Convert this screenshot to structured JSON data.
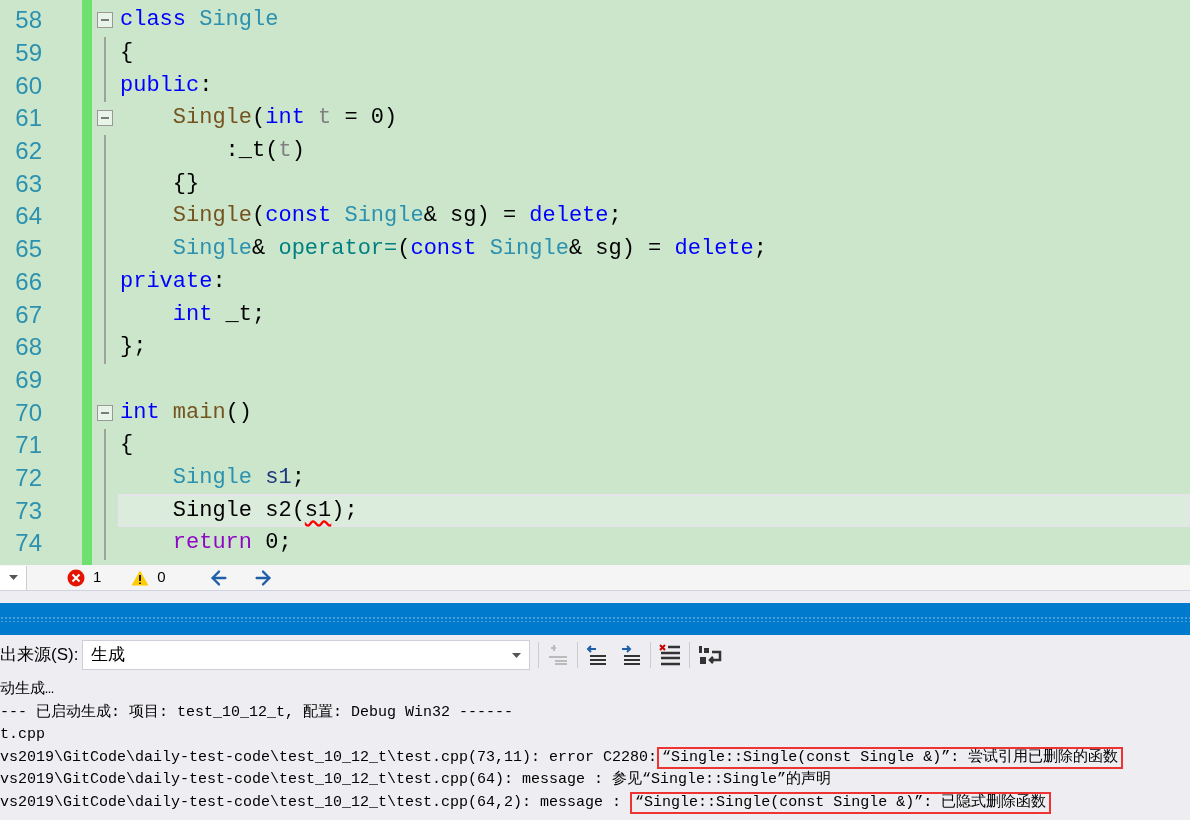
{
  "editor": {
    "lines": [
      {
        "number": "58",
        "fold": true,
        "current": false,
        "tokens": [
          {
            "text": "class ",
            "kind": "keyword"
          },
          {
            "text": "Single",
            "kind": "type"
          }
        ]
      },
      {
        "number": "59",
        "fold": false,
        "current": false,
        "tokens": [
          {
            "text": "{",
            "kind": "plain"
          }
        ]
      },
      {
        "number": "60",
        "fold": false,
        "current": false,
        "tokens": [
          {
            "text": "public",
            "kind": "keyword"
          },
          {
            "text": ":",
            "kind": "plain"
          }
        ]
      },
      {
        "number": "61",
        "fold": true,
        "current": false,
        "tokens": [
          {
            "text": "    Single",
            "kind": "function"
          },
          {
            "text": "(",
            "kind": "plain"
          },
          {
            "text": "int ",
            "kind": "keyword"
          },
          {
            "text": "t",
            "kind": "parameter"
          },
          {
            "text": " = 0)",
            "kind": "plain"
          }
        ]
      },
      {
        "number": "62",
        "fold": false,
        "current": false,
        "tokens": [
          {
            "text": "        :_t(",
            "kind": "plain"
          },
          {
            "text": "t",
            "kind": "parameter"
          },
          {
            "text": ")",
            "kind": "plain"
          }
        ]
      },
      {
        "number": "63",
        "fold": false,
        "current": false,
        "tokens": [
          {
            "text": "    {}",
            "kind": "plain"
          }
        ]
      },
      {
        "number": "64",
        "fold": false,
        "current": false,
        "tokens": [
          {
            "text": "    Single",
            "kind": "function"
          },
          {
            "text": "(",
            "kind": "plain"
          },
          {
            "text": "const ",
            "kind": "keyword"
          },
          {
            "text": "Single",
            "kind": "type"
          },
          {
            "text": "& sg) = ",
            "kind": "plain"
          },
          {
            "text": "delete",
            "kind": "keyword"
          },
          {
            "text": ";",
            "kind": "plain"
          }
        ]
      },
      {
        "number": "65",
        "fold": false,
        "current": false,
        "tokens": [
          {
            "text": "    Single",
            "kind": "type"
          },
          {
            "text": "& ",
            "kind": "plain"
          },
          {
            "text": "operator=",
            "kind": "operator"
          },
          {
            "text": "(",
            "kind": "plain"
          },
          {
            "text": "const ",
            "kind": "keyword"
          },
          {
            "text": "Single",
            "kind": "type"
          },
          {
            "text": "& sg) = ",
            "kind": "plain"
          },
          {
            "text": "delete",
            "kind": "keyword"
          },
          {
            "text": ";",
            "kind": "plain"
          }
        ]
      },
      {
        "number": "66",
        "fold": false,
        "current": false,
        "tokens": [
          {
            "text": "private",
            "kind": "keyword"
          },
          {
            "text": ":",
            "kind": "plain"
          }
        ]
      },
      {
        "number": "67",
        "fold": false,
        "current": false,
        "tokens": [
          {
            "text": "    int",
            "kind": "keyword"
          },
          {
            "text": " _t;",
            "kind": "plain"
          }
        ]
      },
      {
        "number": "68",
        "fold": false,
        "current": false,
        "tokens": [
          {
            "text": "};",
            "kind": "plain"
          }
        ]
      },
      {
        "number": "69",
        "fold": false,
        "current": false
      },
      {
        "number": "70",
        "fold": true,
        "current": false,
        "tokens": [
          {
            "text": "int ",
            "kind": "keyword"
          },
          {
            "text": "main",
            "kind": "function"
          },
          {
            "text": "()",
            "kind": "plain"
          }
        ]
      },
      {
        "number": "71",
        "fold": false,
        "current": false,
        "tokens": [
          {
            "text": "{",
            "kind": "plain"
          }
        ]
      },
      {
        "number": "72",
        "fold": false,
        "current": false,
        "tokens": [
          {
            "text": "    Single ",
            "kind": "type"
          },
          {
            "text": "s1",
            "kind": "local"
          },
          {
            "text": ";",
            "kind": "plain"
          }
        ]
      },
      {
        "number": "73",
        "fold": false,
        "current": true,
        "tokens": [
          {
            "text": "    Single s2(",
            "kind": "plain"
          },
          {
            "text": "s1",
            "kind": "error"
          },
          {
            "text": ");",
            "kind": "plain"
          }
        ]
      },
      {
        "number": "74",
        "fold": false,
        "current": false,
        "tokens": [
          {
            "text": "    return",
            "kind": "control"
          },
          {
            "text": " 0;",
            "kind": "plain"
          }
        ]
      }
    ]
  },
  "status_bar": {
    "errors": "1",
    "warnings": "0"
  },
  "output_panel": {
    "source_label": "出来源(S):",
    "source_value": "生成",
    "lines": [
      {
        "segments": [
          {
            "text": "动生成…",
            "boxed": false
          }
        ]
      },
      {
        "segments": [
          {
            "text": "--- 已启动生成: 项目: test_10_12_t, 配置: Debug Win32 ------",
            "boxed": false
          }
        ]
      },
      {
        "segments": [
          {
            "text": "t.cpp",
            "boxed": false
          }
        ]
      },
      {
        "segments": [
          {
            "text": "vs2019\\GitCode\\daily-test-code\\test_10_12_t\\test.cpp(73,11): error C2280:",
            "boxed": false
          },
          {
            "text": "“Single::Single(const Single &)”: 尝试引用已删除的函数",
            "boxed": true
          }
        ]
      },
      {
        "segments": [
          {
            "text": "vs2019\\GitCode\\daily-test-code\\test_10_12_t\\test.cpp(64): message : 参见“Single::Single”的声明",
            "boxed": false
          }
        ]
      },
      {
        "segments": [
          {
            "text": "vs2019\\GitCode\\daily-test-code\\test_10_12_t\\test.cpp(64,2): message : ",
            "boxed": false
          },
          {
            "text": "“Single::Single(const Single &)”: 已隐式删除函数",
            "boxed": true
          }
        ]
      }
    ]
  }
}
